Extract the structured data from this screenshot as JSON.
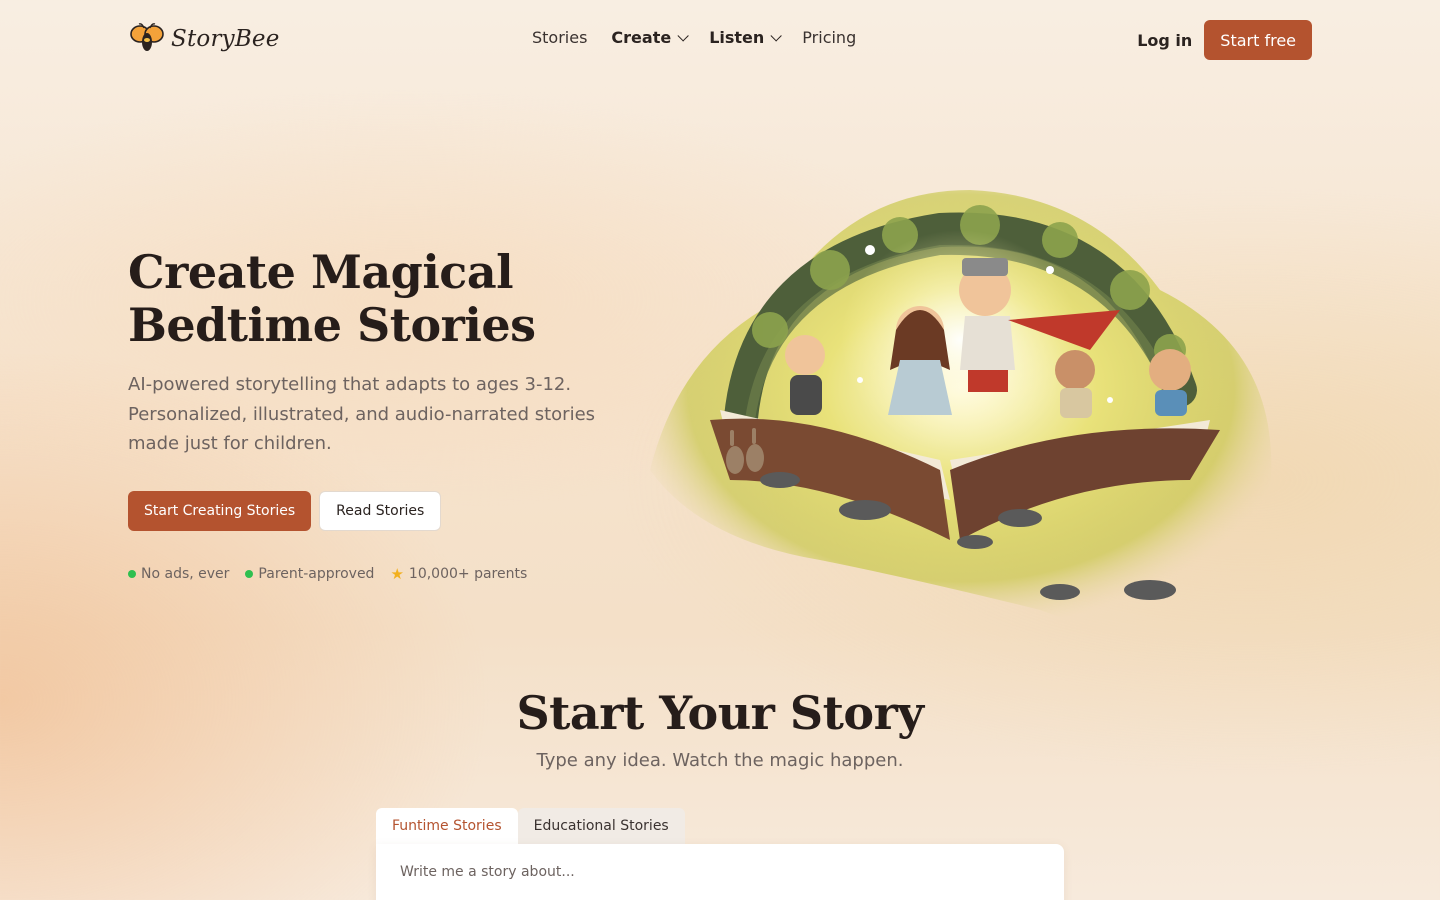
{
  "brand": {
    "name": "StoryBee",
    "accent": "#b4532f"
  },
  "nav": {
    "links": [
      {
        "label": "Stories"
      },
      {
        "label": "Create"
      },
      {
        "label": "Listen"
      },
      {
        "label": "Pricing"
      }
    ],
    "login_label": "Log in",
    "cta_label": "Start free"
  },
  "hero": {
    "title": "Create Magical Bedtime Stories",
    "subtitle": "AI-powered storytelling that adapts to ages 3-12. Personalized, illustrated, and audio-narrated stories made just for children.",
    "primary_button": "Start Creating Stories",
    "secondary_button": "Read Stories",
    "badges": [
      {
        "label": "No ads, ever",
        "icon": "green-dot-icon"
      },
      {
        "label": "Parent-approved",
        "icon": "green-dot-icon"
      },
      {
        "label": "10,000+ parents",
        "icon": "star-icon"
      }
    ]
  },
  "start": {
    "title": "Start Your Story",
    "subtitle": "Type any idea. Watch the magic happen.",
    "tabs": [
      {
        "label": "Funtime Stories",
        "active": true
      },
      {
        "label": "Educational Stories",
        "active": false
      }
    ],
    "input_placeholder": "Write me a story about...",
    "input_value": ""
  }
}
